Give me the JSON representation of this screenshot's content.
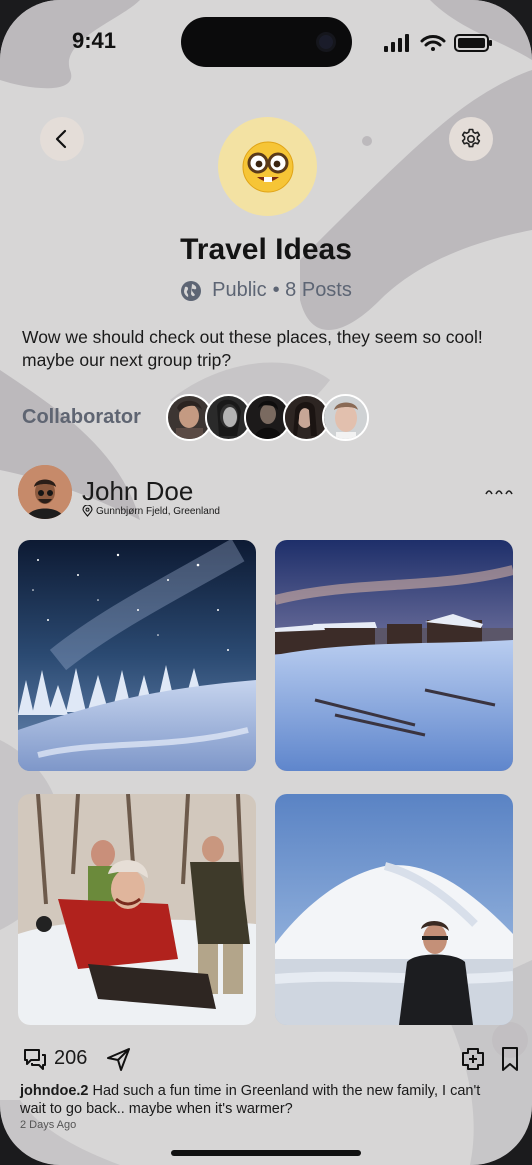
{
  "status_bar": {
    "time": "9:41"
  },
  "header": {
    "emoji": "🤓",
    "title": "Travel Ideas",
    "visibility": "Public",
    "posts": "• 8 Posts"
  },
  "description": "Wow we should check out these places, they seem so cool! maybe our next group trip?",
  "collaborators": {
    "label": "Collaborator",
    "count": 5
  },
  "post": {
    "author": "John Doe",
    "location": "Gunnbjørn Fjeld, Greenland",
    "comment_count": "206",
    "caption_user": "johndoe.2",
    "caption_text": " Had such a fun time in Greenland with the new family, I can't wait to go back.. maybe when it's warmer?",
    "timestamp": "2 Days Ago"
  },
  "colors": {
    "background": "#d7d6d6",
    "accent_emoji_bg": "#f3e2a3",
    "muted_text": "#5d6574"
  },
  "icons": [
    "back-icon",
    "gear-icon",
    "globe-icon",
    "location-pin-icon",
    "more-icon",
    "comment-icon",
    "send-icon",
    "add-to-board-icon",
    "bookmark-icon"
  ]
}
